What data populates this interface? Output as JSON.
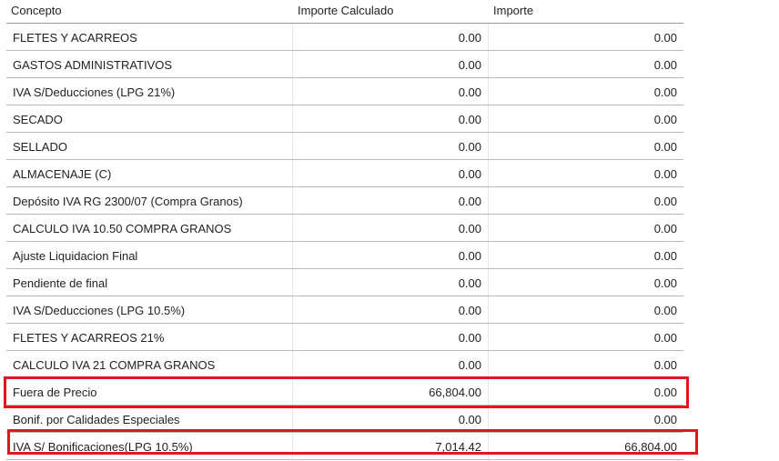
{
  "table": {
    "headers": {
      "concepto": "Concepto",
      "importe_calculado": "Importe Calculado",
      "importe": "Importe"
    },
    "rows": [
      {
        "concepto": "FLETES Y ACARREOS",
        "importe_calculado": "0.00",
        "importe": "0.00"
      },
      {
        "concepto": "GASTOS ADMINISTRATIVOS",
        "importe_calculado": "0.00",
        "importe": "0.00"
      },
      {
        "concepto": "IVA S/Deducciones (LPG 21%)",
        "importe_calculado": "0.00",
        "importe": "0.00"
      },
      {
        "concepto": "SECADO",
        "importe_calculado": "0.00",
        "importe": "0.00"
      },
      {
        "concepto": "SELLADO",
        "importe_calculado": "0.00",
        "importe": "0.00"
      },
      {
        "concepto": "ALMACENAJE (C)",
        "importe_calculado": "0.00",
        "importe": "0.00"
      },
      {
        "concepto": "Depósito IVA RG 2300/07 (Compra Granos)",
        "importe_calculado": "0.00",
        "importe": "0.00"
      },
      {
        "concepto": "CALCULO IVA 10.50 COMPRA GRANOS",
        "importe_calculado": "0.00",
        "importe": "0.00"
      },
      {
        "concepto": "Ajuste Liquidacion Final",
        "importe_calculado": "0.00",
        "importe": "0.00"
      },
      {
        "concepto": "Pendiente de final",
        "importe_calculado": "0.00",
        "importe": "0.00"
      },
      {
        "concepto": "IVA S/Deducciones (LPG 10.5%)",
        "importe_calculado": "0.00",
        "importe": "0.00"
      },
      {
        "concepto": "FLETES Y ACARREOS 21%",
        "importe_calculado": "0.00",
        "importe": "0.00"
      },
      {
        "concepto": "CALCULO IVA 21 COMPRA GRANOS",
        "importe_calculado": "0.00",
        "importe": "0.00"
      },
      {
        "concepto": "Fuera de Precio",
        "importe_calculado": "66,804.00",
        "importe": "0.00"
      },
      {
        "concepto": "Bonif. por Calidades Especiales",
        "importe_calculado": "0.00",
        "importe": "0.00"
      },
      {
        "concepto": "IVA S/ Bonificaciones(LPG 10.5%)",
        "importe_calculado": "7,014.42",
        "importe": "66,804.00"
      }
    ]
  },
  "annotations": {
    "highlight_color": "#e8141b"
  }
}
